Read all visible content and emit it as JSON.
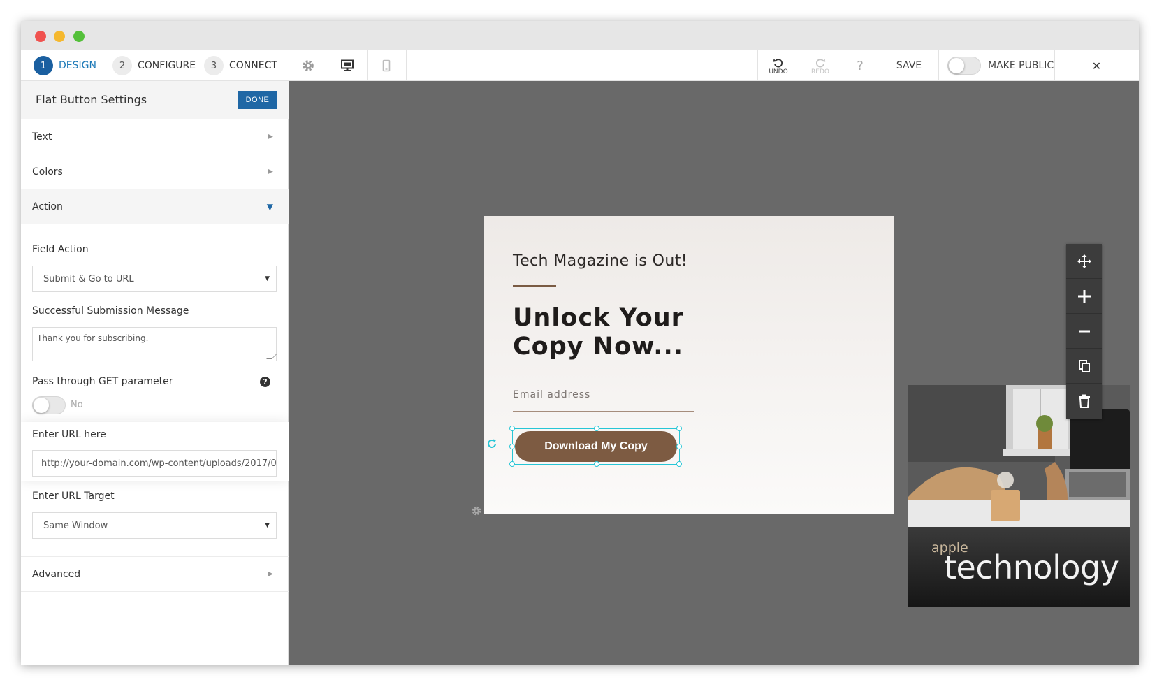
{
  "toolbar": {
    "steps": [
      {
        "num": "1",
        "label": "DESIGN"
      },
      {
        "num": "2",
        "label": "CONFIGURE"
      },
      {
        "num": "3",
        "label": "CONNECT"
      }
    ],
    "undo_label": "UNDO",
    "redo_label": "REDO",
    "help_label": "?",
    "save_label": "SAVE",
    "make_public_label": "MAKE PUBLIC",
    "close_label": "✕"
  },
  "sidebar": {
    "title": "Flat Button Settings",
    "done_label": "DONE",
    "sections": {
      "text": "Text",
      "colors": "Colors",
      "action": "Action",
      "advanced": "Advanced"
    },
    "action": {
      "field_action_label": "Field Action",
      "field_action_value": "Submit & Go to URL",
      "success_message_label": "Successful Submission Message",
      "success_message_value": "Thank you for subscribing.",
      "pass_get_label": "Pass through GET parameter",
      "pass_get_help": "?",
      "pass_get_state": "No",
      "url_label": "Enter URL here",
      "url_value": "http://your-domain.com/wp-content/uploads/2017/0",
      "url_target_label": "Enter URL Target",
      "url_target_value": "Same Window"
    }
  },
  "card": {
    "kicker": "Tech Magazine is Out!",
    "headline": "Unlock Your Copy Now...",
    "email_placeholder": "Email address",
    "cta_label": "Download My Copy",
    "book_brand": "apple",
    "book_title": "technology"
  },
  "colors": {
    "accent": "#1f67a5",
    "cta": "#7d5b42",
    "selection": "#27c6d6",
    "canvas": "#696969"
  },
  "icons": [
    "settings-gear-icon",
    "desktop-view-icon",
    "mobile-view-icon",
    "undo-icon",
    "redo-icon",
    "help-icon",
    "close-icon",
    "move-icon",
    "zoom-in-icon",
    "zoom-out-icon",
    "duplicate-icon",
    "trash-icon",
    "rotate-icon",
    "card-settings-gear-icon"
  ]
}
